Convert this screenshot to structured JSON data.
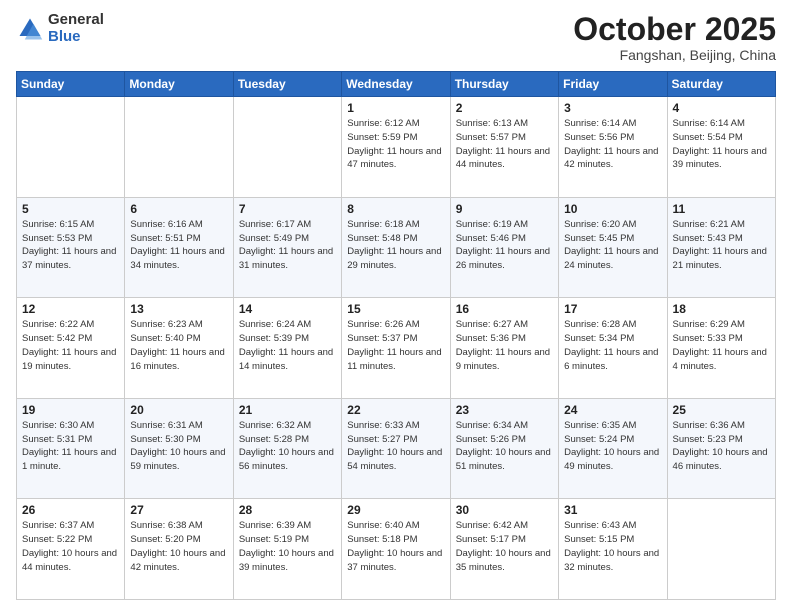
{
  "header": {
    "logo_general": "General",
    "logo_blue": "Blue",
    "month_title": "October 2025",
    "subtitle": "Fangshan, Beijing, China"
  },
  "weekdays": [
    "Sunday",
    "Monday",
    "Tuesday",
    "Wednesday",
    "Thursday",
    "Friday",
    "Saturday"
  ],
  "weeks": [
    [
      {
        "day": "",
        "info": ""
      },
      {
        "day": "",
        "info": ""
      },
      {
        "day": "",
        "info": ""
      },
      {
        "day": "1",
        "info": "Sunrise: 6:12 AM\nSunset: 5:59 PM\nDaylight: 11 hours and 47 minutes."
      },
      {
        "day": "2",
        "info": "Sunrise: 6:13 AM\nSunset: 5:57 PM\nDaylight: 11 hours and 44 minutes."
      },
      {
        "day": "3",
        "info": "Sunrise: 6:14 AM\nSunset: 5:56 PM\nDaylight: 11 hours and 42 minutes."
      },
      {
        "day": "4",
        "info": "Sunrise: 6:14 AM\nSunset: 5:54 PM\nDaylight: 11 hours and 39 minutes."
      }
    ],
    [
      {
        "day": "5",
        "info": "Sunrise: 6:15 AM\nSunset: 5:53 PM\nDaylight: 11 hours and 37 minutes."
      },
      {
        "day": "6",
        "info": "Sunrise: 6:16 AM\nSunset: 5:51 PM\nDaylight: 11 hours and 34 minutes."
      },
      {
        "day": "7",
        "info": "Sunrise: 6:17 AM\nSunset: 5:49 PM\nDaylight: 11 hours and 31 minutes."
      },
      {
        "day": "8",
        "info": "Sunrise: 6:18 AM\nSunset: 5:48 PM\nDaylight: 11 hours and 29 minutes."
      },
      {
        "day": "9",
        "info": "Sunrise: 6:19 AM\nSunset: 5:46 PM\nDaylight: 11 hours and 26 minutes."
      },
      {
        "day": "10",
        "info": "Sunrise: 6:20 AM\nSunset: 5:45 PM\nDaylight: 11 hours and 24 minutes."
      },
      {
        "day": "11",
        "info": "Sunrise: 6:21 AM\nSunset: 5:43 PM\nDaylight: 11 hours and 21 minutes."
      }
    ],
    [
      {
        "day": "12",
        "info": "Sunrise: 6:22 AM\nSunset: 5:42 PM\nDaylight: 11 hours and 19 minutes."
      },
      {
        "day": "13",
        "info": "Sunrise: 6:23 AM\nSunset: 5:40 PM\nDaylight: 11 hours and 16 minutes."
      },
      {
        "day": "14",
        "info": "Sunrise: 6:24 AM\nSunset: 5:39 PM\nDaylight: 11 hours and 14 minutes."
      },
      {
        "day": "15",
        "info": "Sunrise: 6:26 AM\nSunset: 5:37 PM\nDaylight: 11 hours and 11 minutes."
      },
      {
        "day": "16",
        "info": "Sunrise: 6:27 AM\nSunset: 5:36 PM\nDaylight: 11 hours and 9 minutes."
      },
      {
        "day": "17",
        "info": "Sunrise: 6:28 AM\nSunset: 5:34 PM\nDaylight: 11 hours and 6 minutes."
      },
      {
        "day": "18",
        "info": "Sunrise: 6:29 AM\nSunset: 5:33 PM\nDaylight: 11 hours and 4 minutes."
      }
    ],
    [
      {
        "day": "19",
        "info": "Sunrise: 6:30 AM\nSunset: 5:31 PM\nDaylight: 11 hours and 1 minute."
      },
      {
        "day": "20",
        "info": "Sunrise: 6:31 AM\nSunset: 5:30 PM\nDaylight: 10 hours and 59 minutes."
      },
      {
        "day": "21",
        "info": "Sunrise: 6:32 AM\nSunset: 5:28 PM\nDaylight: 10 hours and 56 minutes."
      },
      {
        "day": "22",
        "info": "Sunrise: 6:33 AM\nSunset: 5:27 PM\nDaylight: 10 hours and 54 minutes."
      },
      {
        "day": "23",
        "info": "Sunrise: 6:34 AM\nSunset: 5:26 PM\nDaylight: 10 hours and 51 minutes."
      },
      {
        "day": "24",
        "info": "Sunrise: 6:35 AM\nSunset: 5:24 PM\nDaylight: 10 hours and 49 minutes."
      },
      {
        "day": "25",
        "info": "Sunrise: 6:36 AM\nSunset: 5:23 PM\nDaylight: 10 hours and 46 minutes."
      }
    ],
    [
      {
        "day": "26",
        "info": "Sunrise: 6:37 AM\nSunset: 5:22 PM\nDaylight: 10 hours and 44 minutes."
      },
      {
        "day": "27",
        "info": "Sunrise: 6:38 AM\nSunset: 5:20 PM\nDaylight: 10 hours and 42 minutes."
      },
      {
        "day": "28",
        "info": "Sunrise: 6:39 AM\nSunset: 5:19 PM\nDaylight: 10 hours and 39 minutes."
      },
      {
        "day": "29",
        "info": "Sunrise: 6:40 AM\nSunset: 5:18 PM\nDaylight: 10 hours and 37 minutes."
      },
      {
        "day": "30",
        "info": "Sunrise: 6:42 AM\nSunset: 5:17 PM\nDaylight: 10 hours and 35 minutes."
      },
      {
        "day": "31",
        "info": "Sunrise: 6:43 AM\nSunset: 5:15 PM\nDaylight: 10 hours and 32 minutes."
      },
      {
        "day": "",
        "info": ""
      }
    ]
  ]
}
